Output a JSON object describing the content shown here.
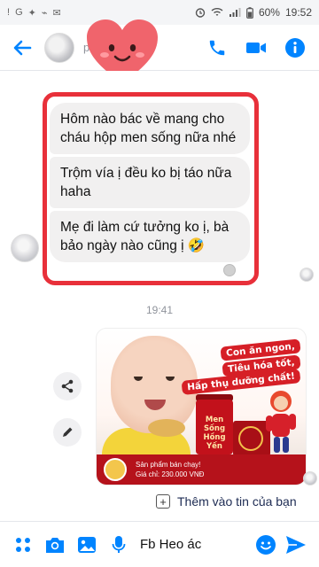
{
  "status_bar": {
    "left_indicators": [
      "!",
      "G",
      "✦",
      "⌁",
      "✉"
    ],
    "battery": "60%",
    "time": "19:52"
  },
  "header": {
    "name_partial": "ph...",
    "accent_color": "#0084ff"
  },
  "messages": [
    {
      "text": "Hôm nào bác về mang cho cháu hộp men sống nữa nhé"
    },
    {
      "text": "Trộm vía ị đều ko bị táo nữa haha"
    },
    {
      "text": "Mẹ đi làm cứ tưởng ko ị, bà bảo ngày nào cũng ị 🤣"
    }
  ],
  "timestamp": "19:41",
  "ad": {
    "slogan": [
      "Con ăn ngon,",
      "Tiêu hóa tốt,",
      "Hấp thụ dưỡng chất!"
    ],
    "product_label": "Men Sống Hồng Yến",
    "banner_line1": "Sản phẩm bán chạy!",
    "banner_line2": "Giá chỉ: 230.000 VNĐ"
  },
  "add_contact_label": "Thêm vào tin của bạn",
  "composer": {
    "input_value": "Fb Heo ác"
  },
  "colors": {
    "highlight": "#e8303a",
    "bubble": "#f1f0f0",
    "heart": "#f0646c"
  }
}
